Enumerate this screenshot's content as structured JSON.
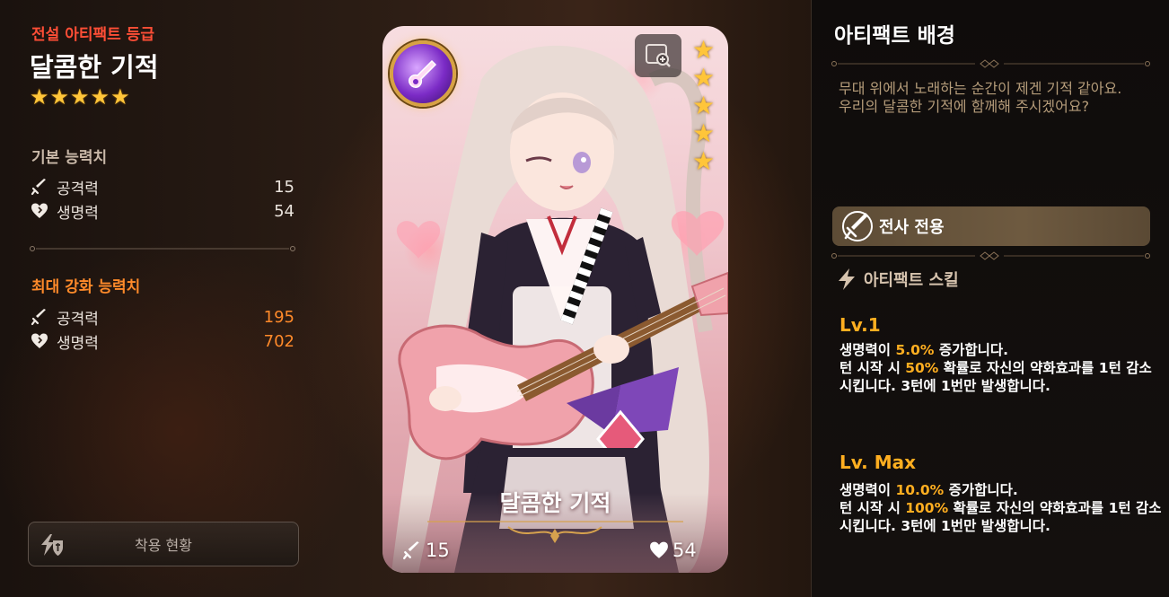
{
  "left": {
    "grade_label": "전설 아티팩트 등급",
    "artifact_name": "달콤한 기적",
    "stars": [
      "★",
      "★",
      "★",
      "★",
      "★"
    ],
    "base_stats": {
      "title": "기본 능력치",
      "attack_label": "공격력",
      "attack_value": "15",
      "health_label": "생명력",
      "health_value": "54"
    },
    "max_stats": {
      "title": "최대 강화 능력치",
      "attack_label": "공격력",
      "attack_value": "195",
      "health_label": "생명력",
      "health_value": "702"
    },
    "equip_button_label": "착용 현황"
  },
  "card": {
    "name": "달콤한 기적",
    "stars": [
      "★",
      "★",
      "★",
      "★",
      "★"
    ],
    "attack": "15",
    "health": "54"
  },
  "right": {
    "background_title": "아티팩트 배경",
    "background_text": "무대 위에서 노래하는 순간이 제겐 기적 같아요. 우리의 달콤한 기적에 함께해 주시겠어요?",
    "class_label": "전사 전용",
    "skill_title": "아티팩트 스킬",
    "lv1": {
      "label": "Lv.1",
      "line1_a": "생명력이 ",
      "line1_hl": "5.0%",
      "line1_b": " 증가합니다.",
      "line2_a": "턴 시작 시 ",
      "line2_hl": "50%",
      "line2_b": " 확률로 자신의 약화효과를 1턴 감소시킵니다. 3턴에 1번만 발생합니다."
    },
    "lvmax": {
      "label": "Lv. Max",
      "line1_a": "생명력이 ",
      "line1_hl": "10.0%",
      "line1_b": " 증가합니다.",
      "line2_a": "턴 시작 시 ",
      "line2_hl": "100%",
      "line2_b": " 확률로 자신의 약화효과를 1턴 감소시킵니다. 3턴에 1번만 발생합니다."
    }
  },
  "colors": {
    "grade_red": "#ff4e36",
    "max_orange": "#ff8a2a",
    "highlight_orange": "#ffae20",
    "star_gold": "#ffc53a"
  }
}
